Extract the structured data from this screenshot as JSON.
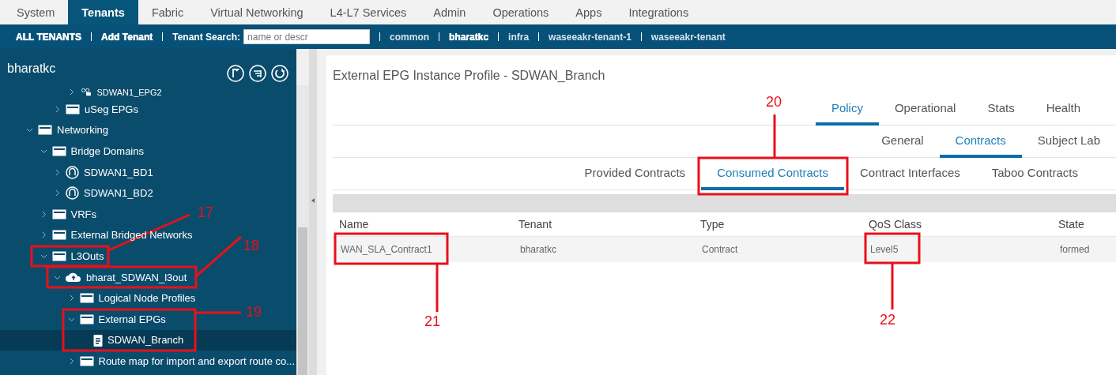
{
  "top_nav": [
    {
      "label": "System",
      "selected": false
    },
    {
      "label": "Tenants",
      "selected": true
    },
    {
      "label": "Fabric",
      "selected": false
    },
    {
      "label": "Virtual Networking",
      "selected": false
    },
    {
      "label": "L4-L7 Services",
      "selected": false
    },
    {
      "label": "Admin",
      "selected": false
    },
    {
      "label": "Operations",
      "selected": false
    },
    {
      "label": "Apps",
      "selected": false
    },
    {
      "label": "Integrations",
      "selected": false
    }
  ],
  "tenant_bar": {
    "links": [
      {
        "label": "ALL TENANTS"
      },
      {
        "label": "Add Tenant"
      }
    ],
    "search_label": "Tenant Search:",
    "search": {
      "placeholder": "name or descr"
    },
    "tenants": [
      {
        "label": "common",
        "selected": false
      },
      {
        "label": "bharatkc",
        "selected": true
      },
      {
        "label": "infra",
        "selected": false
      },
      {
        "label": "waseeakr-tenant-1",
        "selected": false
      },
      {
        "label": "waseeakr-tenant",
        "selected": false
      }
    ]
  },
  "sidebar": {
    "title": "bharatkc",
    "tree": [
      {
        "children": [
          {
            "children": [
              {
                "children": [
                  {
                    "label": "SDWAN1_EPG2",
                    "kind": "epg",
                    "expanded": false,
                    "selected": false
                  }
                ]
              },
              {
                "label": "uSeg EPGs",
                "kind": "folder",
                "expanded": false,
                "selected": false
              }
            ]
          }
        ]
      },
      {
        "label": "Networking",
        "kind": "folder",
        "expanded": true,
        "selected": false,
        "children": [
          {
            "label": "Bridge Domains",
            "kind": "folder",
            "expanded": true,
            "selected": false,
            "children": [
              {
                "label": "SDWAN1_BD1",
                "kind": "bd",
                "expanded": false,
                "selected": false
              },
              {
                "label": "SDWAN1_BD2",
                "kind": "bd",
                "expanded": false,
                "selected": false
              }
            ]
          },
          {
            "label": "VRFs",
            "kind": "folder",
            "expanded": false,
            "selected": false
          },
          {
            "label": "External Bridged Networks",
            "kind": "folder",
            "expanded": false,
            "selected": false
          },
          {
            "label": "L3Outs",
            "kind": "folder",
            "expanded": true,
            "selected": false,
            "children": [
              {
                "label": "bharat_SDWAN_l3out",
                "kind": "l3out",
                "expanded": true,
                "selected": false,
                "children": [
                  {
                    "label": "Logical Node Profiles",
                    "kind": "folder",
                    "expanded": false,
                    "selected": false
                  },
                  {
                    "label": "External EPGs",
                    "kind": "folder",
                    "expanded": true,
                    "selected": false,
                    "children": [
                      {
                        "label": "SDWAN_Branch",
                        "kind": "doc",
                        "selected": true
                      }
                    ]
                  },
                  {
                    "label": "Route map for import and export route co...",
                    "kind": "folder",
                    "expanded": false,
                    "selected": false
                  }
                ]
              }
            ]
          }
        ]
      }
    ]
  },
  "panel": {
    "title": "External EPG Instance Profile - SDWAN_Branch",
    "tabs": [
      {
        "label": "Policy",
        "selected": true
      },
      {
        "label": "Operational",
        "selected": false
      },
      {
        "label": "Stats",
        "selected": false
      },
      {
        "label": "Health",
        "selected": false
      }
    ],
    "subtabs": [
      {
        "label": "General",
        "selected": false
      },
      {
        "label": "Contracts",
        "selected": true
      },
      {
        "label": "Subject Lab",
        "selected": false
      }
    ],
    "contract_tabs": [
      {
        "label": "Provided Contracts",
        "selected": false
      },
      {
        "label": "Consumed Contracts",
        "selected": true
      },
      {
        "label": "Contract Interfaces",
        "selected": false
      },
      {
        "label": "Taboo Contracts",
        "selected": false
      }
    ],
    "table": {
      "columns": [
        "Name",
        "Tenant",
        "Type",
        "QoS Class",
        "State"
      ],
      "rows": [
        [
          "WAN_SLA_Contract1",
          "bharatkc",
          "Contract",
          "Level5",
          "formed"
        ]
      ]
    }
  },
  "annotations": [
    {
      "number": "17"
    },
    {
      "number": "18"
    },
    {
      "number": "19"
    },
    {
      "number": "20"
    },
    {
      "number": "21"
    },
    {
      "number": "22"
    }
  ]
}
